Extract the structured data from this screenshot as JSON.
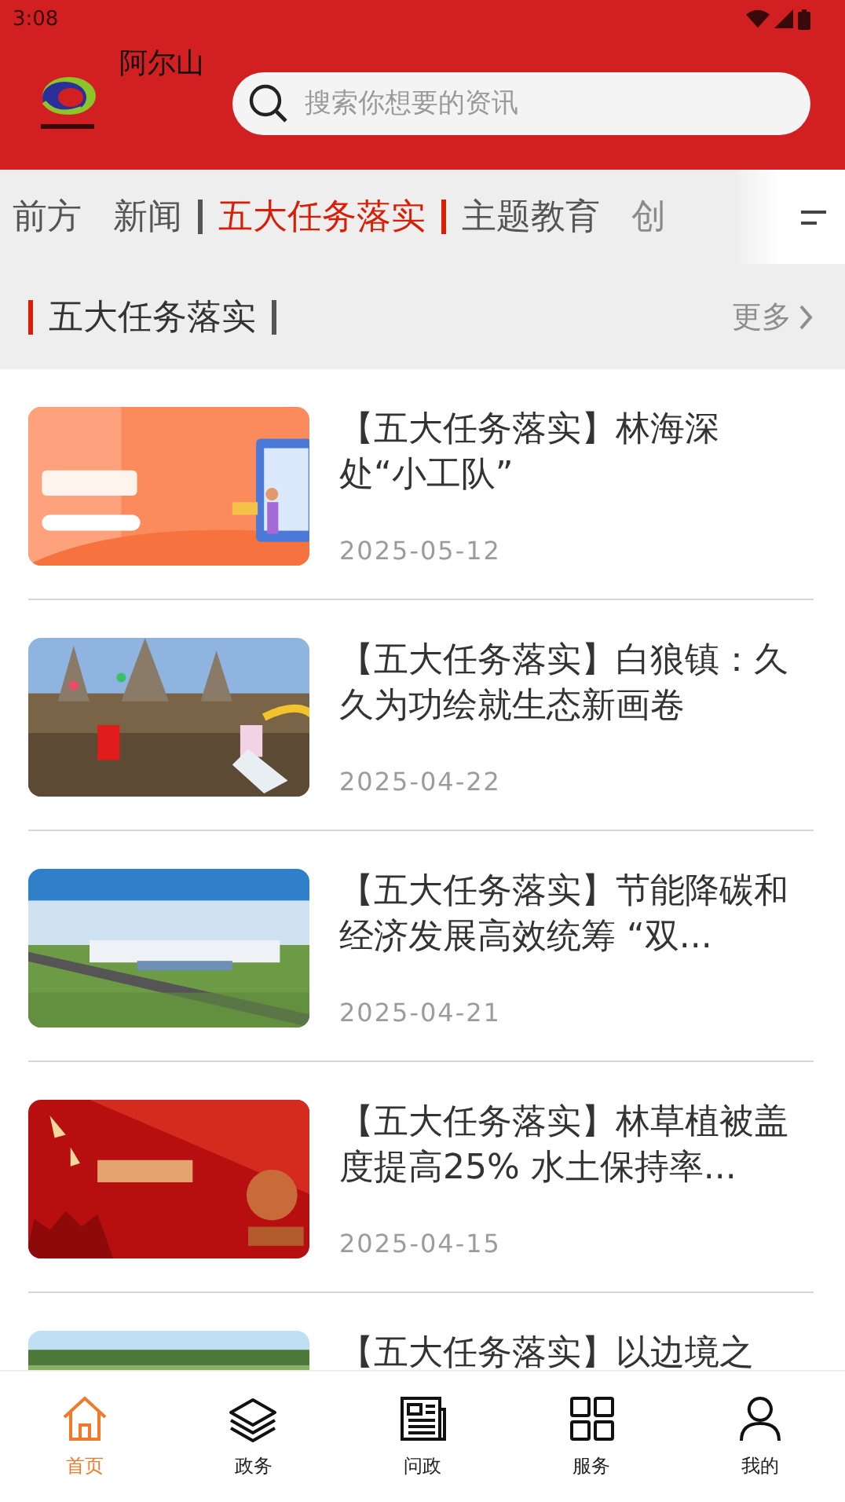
{
  "status_bar": {
    "time": "3:08"
  },
  "header": {
    "logo_name": "阿尔山",
    "search": {
      "placeholder": "搜索你想要的资讯"
    }
  },
  "tabs": [
    {
      "label": "前方",
      "selected": false
    },
    {
      "label": "新闻",
      "selected": false
    },
    {
      "label": "五大任务落实",
      "selected": true
    },
    {
      "label": "主题教育",
      "selected": false
    },
    {
      "label": "创",
      "selected": false
    }
  ],
  "section": {
    "title": "五大任务落实",
    "more": "更多"
  },
  "articles": [
    {
      "title": "【五大任务落实】林海深处“小工队”",
      "date": "2025-05-12"
    },
    {
      "title": "【五大任务落实】白狼镇：久久为功绘就生态新画卷",
      "date": "2025-04-22"
    },
    {
      "title": "【五大任务落实】节能降碳和经济发展高效统筹 “双...",
      "date": "2025-04-21"
    },
    {
      "title": "【五大任务落实】林草植被盖度提高25%  水土保持率...",
      "date": "2025-04-15"
    },
    {
      "title": "【五大任务落实】以边境之"
    }
  ],
  "bottom_nav": [
    {
      "label": "首页",
      "selected": true
    },
    {
      "label": "政务",
      "selected": false
    },
    {
      "label": "问政",
      "selected": false
    },
    {
      "label": "服务",
      "selected": false
    },
    {
      "label": "我的",
      "selected": false
    }
  ]
}
